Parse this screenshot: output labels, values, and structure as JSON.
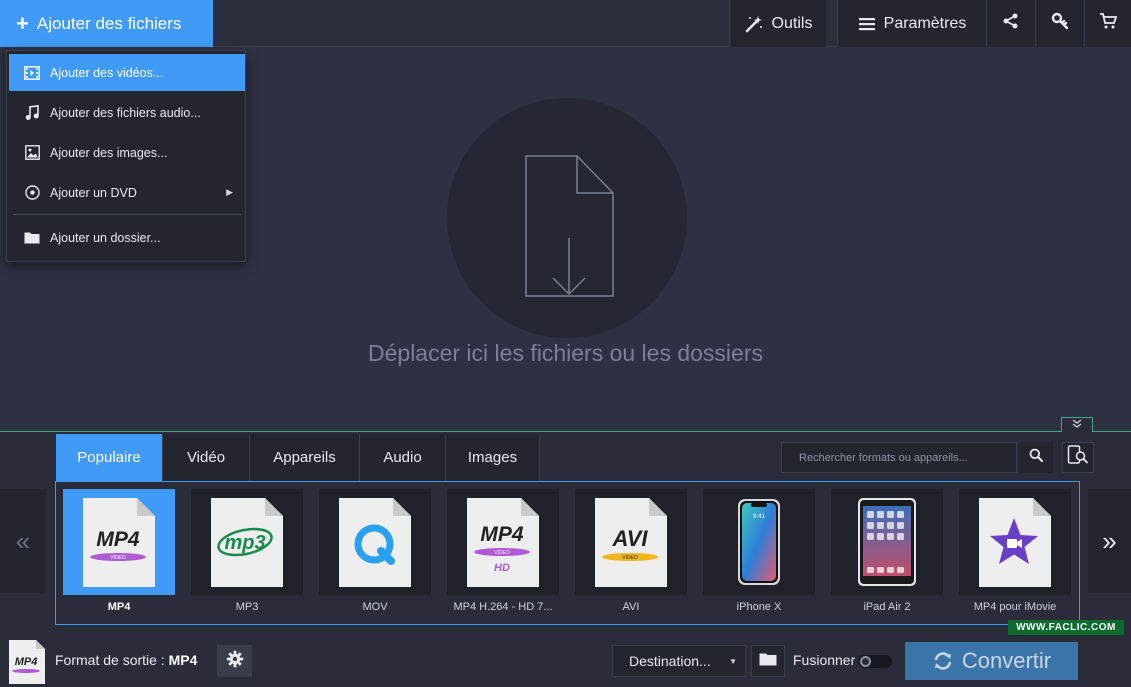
{
  "toolbar": {
    "add_files_label": "Ajouter des fichiers",
    "tools_label": "Outils",
    "settings_label": "Paramètres",
    "share_icon": "share-icon",
    "key_icon": "key-icon",
    "cart_icon": "cart-icon"
  },
  "add_menu": {
    "items": [
      {
        "label": "Ajouter des vidéos...",
        "icon": "film-icon",
        "active": true
      },
      {
        "label": "Ajouter des fichiers audio...",
        "icon": "music-note-icon"
      },
      {
        "label": "Ajouter des images...",
        "icon": "image-icon"
      },
      {
        "label": "Ajouter un DVD",
        "icon": "disc-icon",
        "submenu": true
      },
      {
        "label": "Ajouter un dossier...",
        "icon": "folder-icon"
      }
    ]
  },
  "dropzone": {
    "text": "Déplacer ici les fichiers ou les dossiers"
  },
  "format_tabs": [
    "Populaire",
    "Vidéo",
    "Appareils",
    "Audio",
    "Images"
  ],
  "active_tab": "Populaire",
  "search": {
    "placeholder": "Rechercher formats ou appareils..."
  },
  "formats": [
    {
      "label": "MP4",
      "badge": "MP4",
      "sub": "VIDEO",
      "active": true
    },
    {
      "label": "MP3",
      "badge": "mp3"
    },
    {
      "label": "MOV",
      "badge": "Q"
    },
    {
      "label": "MP4 H.264 - HD 7...",
      "badge": "MP4",
      "sub": "VIDEO",
      "extra": "HD"
    },
    {
      "label": "AVI",
      "badge": "AVI",
      "sub": "VIDEO"
    },
    {
      "label": "iPhone X",
      "badge": "9:41"
    },
    {
      "label": "iPad Air 2"
    },
    {
      "label": "MP4 pour iMovie"
    }
  ],
  "nav": {
    "prev": "«",
    "next": "»"
  },
  "footer": {
    "output_prefix": "Format de sortie :",
    "output_format": "MP4",
    "output_badge": "MP4",
    "destination_label": "Destination...",
    "merge_label": "Fusionner",
    "convert_label": "Convertir"
  },
  "watermark": "WWW.FACLIC.COM",
  "colors": {
    "accent": "#3f9bf7",
    "background": "#2d3142",
    "panel": "#2a2d39",
    "convert": "#3b74a8",
    "mp4_purple": "#b05bd6",
    "mp3_green": "#1a8a4e",
    "mov_blue": "#2aa1f0",
    "avi_yellow": "#f3b61b",
    "imovie_purple": "#6a3fc7"
  }
}
